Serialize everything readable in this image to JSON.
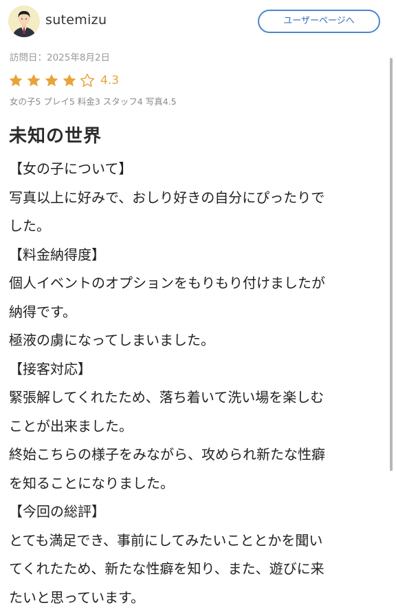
{
  "user": {
    "name": "sutemizu",
    "avatar_icon": "user-avatar-icon",
    "user_page_button": "ユーザーページへ"
  },
  "review": {
    "visit_date": "訪問日：2025年8月2日",
    "rating": {
      "stars_filled": 4,
      "stars_total": 5,
      "value": "4.3",
      "star_color": "#e8a33a"
    },
    "sub_ratings": "女の子5 プレイ5 料金3 スタッフ4 写真4.5",
    "title": "未知の世界",
    "lines": [
      "【女の子について】",
      "写真以上に好みで、おしり好きの自分にぴったりで",
      "した。",
      "【料金納得度】",
      "個人イベントのオプションをもりもり付けましたが",
      "納得です。",
      "極液の虜になってしまいました。",
      "【接客対応】",
      "緊張解してくれたため、落ち着いて洗い場を楽しむ",
      "ことが出来ました。",
      "終始こちらの様子をみながら、攻められ新たな性癖",
      "を知ることになりました。",
      "【今回の総評】",
      "とても満足でき、事前にしてみたいこととかを聞い",
      "てくれたため、新たな性癖を知り、また、遊びに来",
      "たいと思っています。"
    ]
  },
  "colors": {
    "accent_blue": "#4a86c8",
    "muted_text": "#999999"
  }
}
